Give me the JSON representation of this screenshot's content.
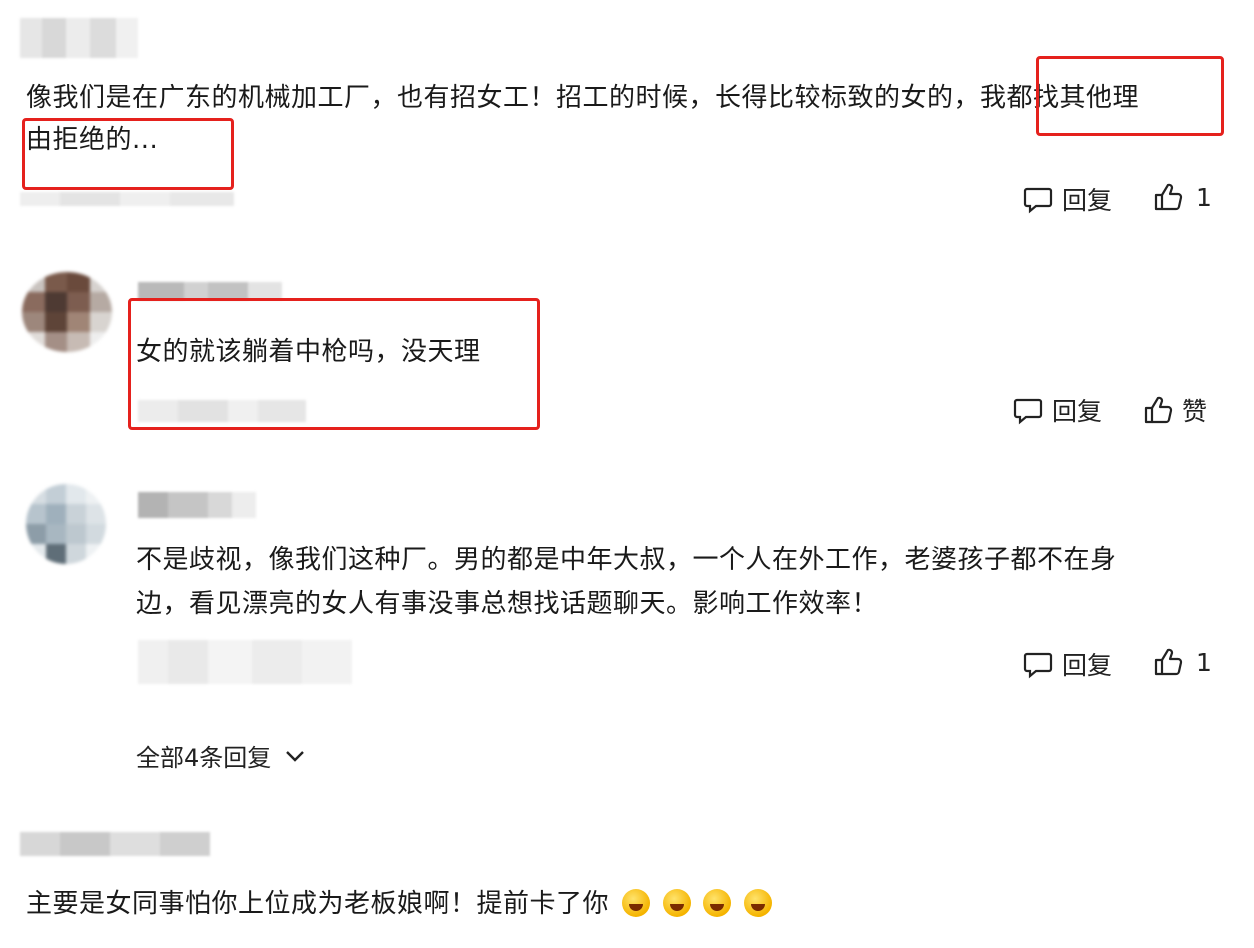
{
  "comments": [
    {
      "text_line1": "像我们是在广东的机械加工厂，也有招女工！招工的时候，长得比较标致的女的，我都找其他理",
      "text_line2": "由拒绝的...",
      "reply_label": "回复",
      "like_label": "1"
    },
    {
      "text_line1": "女的就该躺着中枪吗，没天理",
      "reply_label": "回复",
      "like_label": "赞"
    },
    {
      "text_line1": "不是歧视，像我们这种厂。男的都是中年大叔，一个人在外工作，老婆孩子都不在身",
      "text_line2": "边，看见漂亮的女人有事没事总想找话题聊天。影响工作效率！",
      "reply_label": "回复",
      "like_label": "1",
      "view_all_label": "全部4条回复"
    },
    {
      "text_line1": "主要是女同事怕你上位成为老板娘啊！提前卡了你"
    }
  ],
  "emojis": [
    "laugh-cry-emoji",
    "laugh-cry-emoji",
    "laugh-cry-emoji",
    "smile-emoji"
  ],
  "colors": {
    "highlight_box": "#e5211d",
    "text": "#1a1a1a",
    "background": "#ffffff"
  }
}
